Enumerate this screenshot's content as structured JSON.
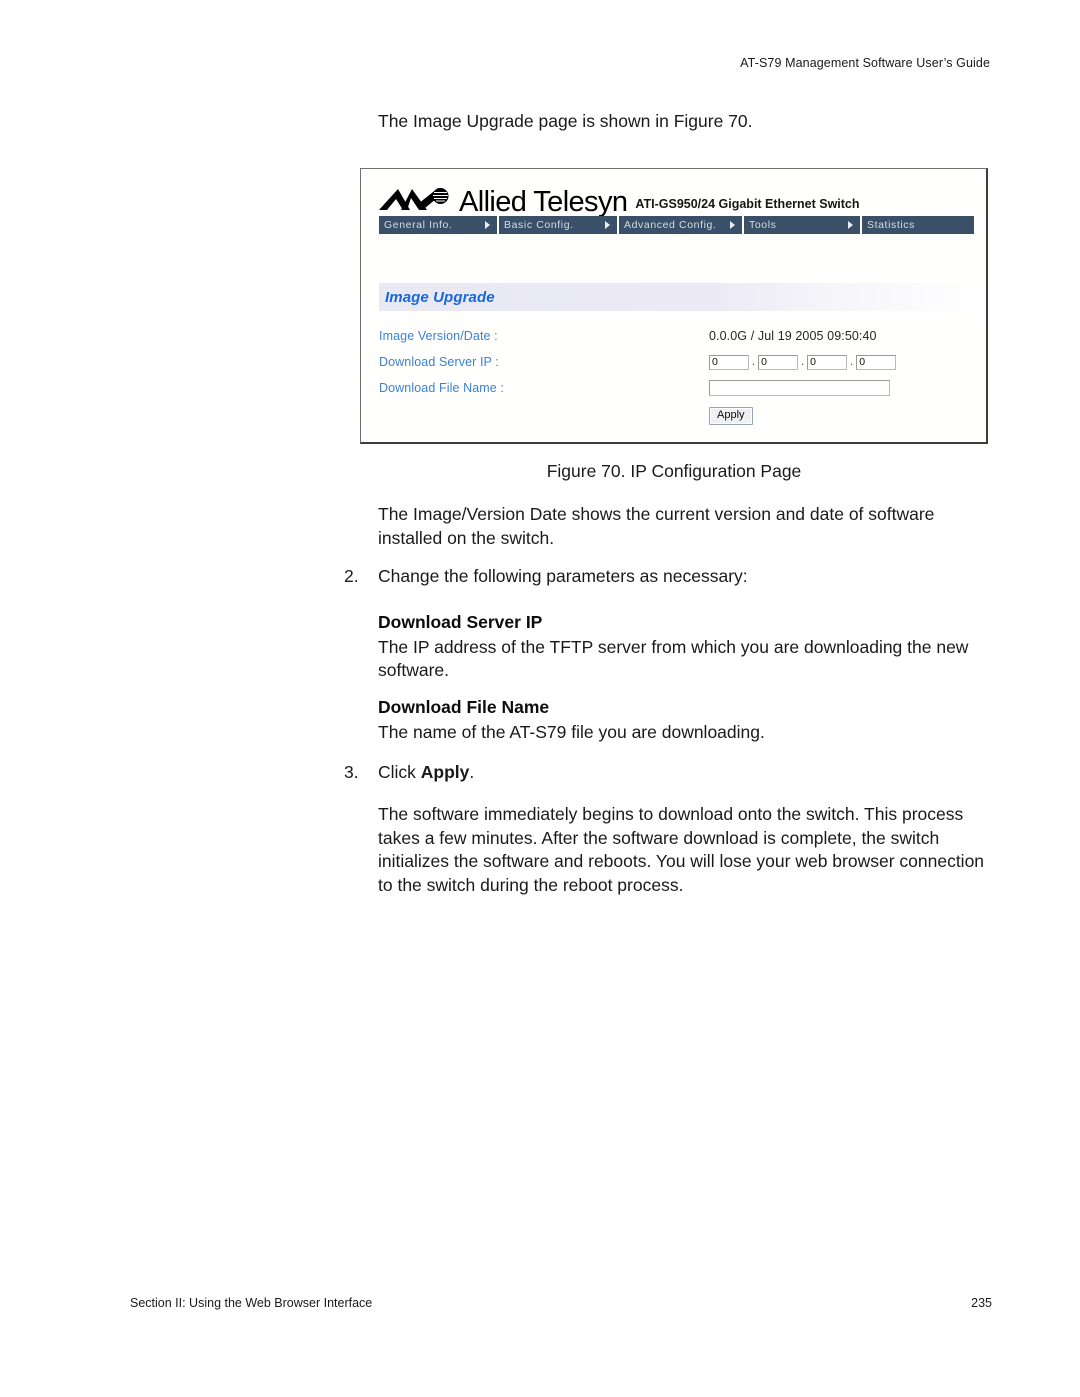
{
  "header": {
    "running_title": "AT-S79 Management Software User’s Guide"
  },
  "intro": {
    "text": "The Image Upgrade page is shown in Figure 70."
  },
  "figure": {
    "caption": "Figure 70. IP Configuration Page",
    "switch_ui": {
      "brand": {
        "logo_icon": "allied-telesyn-logo-icon",
        "name": "Allied Telesyn",
        "model": "ATI-GS950/24 Gigabit Ethernet Switch"
      },
      "nav": {
        "arrow_icon": "chevron-right-icon",
        "items": [
          {
            "label": "General Info.",
            "has_arrow": true
          },
          {
            "label": "Basic Config.",
            "has_arrow": true
          },
          {
            "label": "Advanced Config.",
            "has_arrow": true
          },
          {
            "label": "Tools",
            "has_arrow": true
          },
          {
            "label": "Statistics",
            "has_arrow": false
          }
        ]
      },
      "panel": {
        "title": "Image Upgrade",
        "fields": {
          "image_version_label": "Image Version/Date :",
          "image_version_value": "0.0.0G / Jul 19 2005 09:50:40",
          "server_ip_label": "Download Server IP :",
          "server_ip_octets": [
            "0",
            "0",
            "0",
            "0"
          ],
          "ip_separator": ".",
          "file_name_label": "Download File Name :",
          "file_name_value": ""
        },
        "apply_label": "Apply"
      },
      "colors": {
        "nav_background": "#3a5068",
        "nav_text": "#d4dde4",
        "panel_title": "#1767dd",
        "field_label": "#3a81d8"
      }
    }
  },
  "body": {
    "after_figure": "The Image/Version Date shows the current version and date of software installed on the switch.",
    "step2_num": "2.",
    "step2_text": "Change the following parameters as necessary:",
    "download_server_ip_heading": "Download Server IP",
    "download_server_ip_text": "The IP address of the TFTP server from which you are downloading the new software.",
    "download_file_name_heading": "Download File Name",
    "download_file_name_text": "The name of the AT-S79 file you are downloading.",
    "step3_num": "3.",
    "step3_text_prefix": "Click ",
    "step3_text_bold": "Apply",
    "step3_text_suffix": ".",
    "final_paragraph": "The software immediately begins to download onto the switch. This process takes a few minutes. After the software download is complete, the switch initializes the software and reboots. You will lose your web browser connection to the switch during the reboot process."
  },
  "footer": {
    "section": "Section II: Using the Web Browser Interface",
    "page_number": "235"
  }
}
